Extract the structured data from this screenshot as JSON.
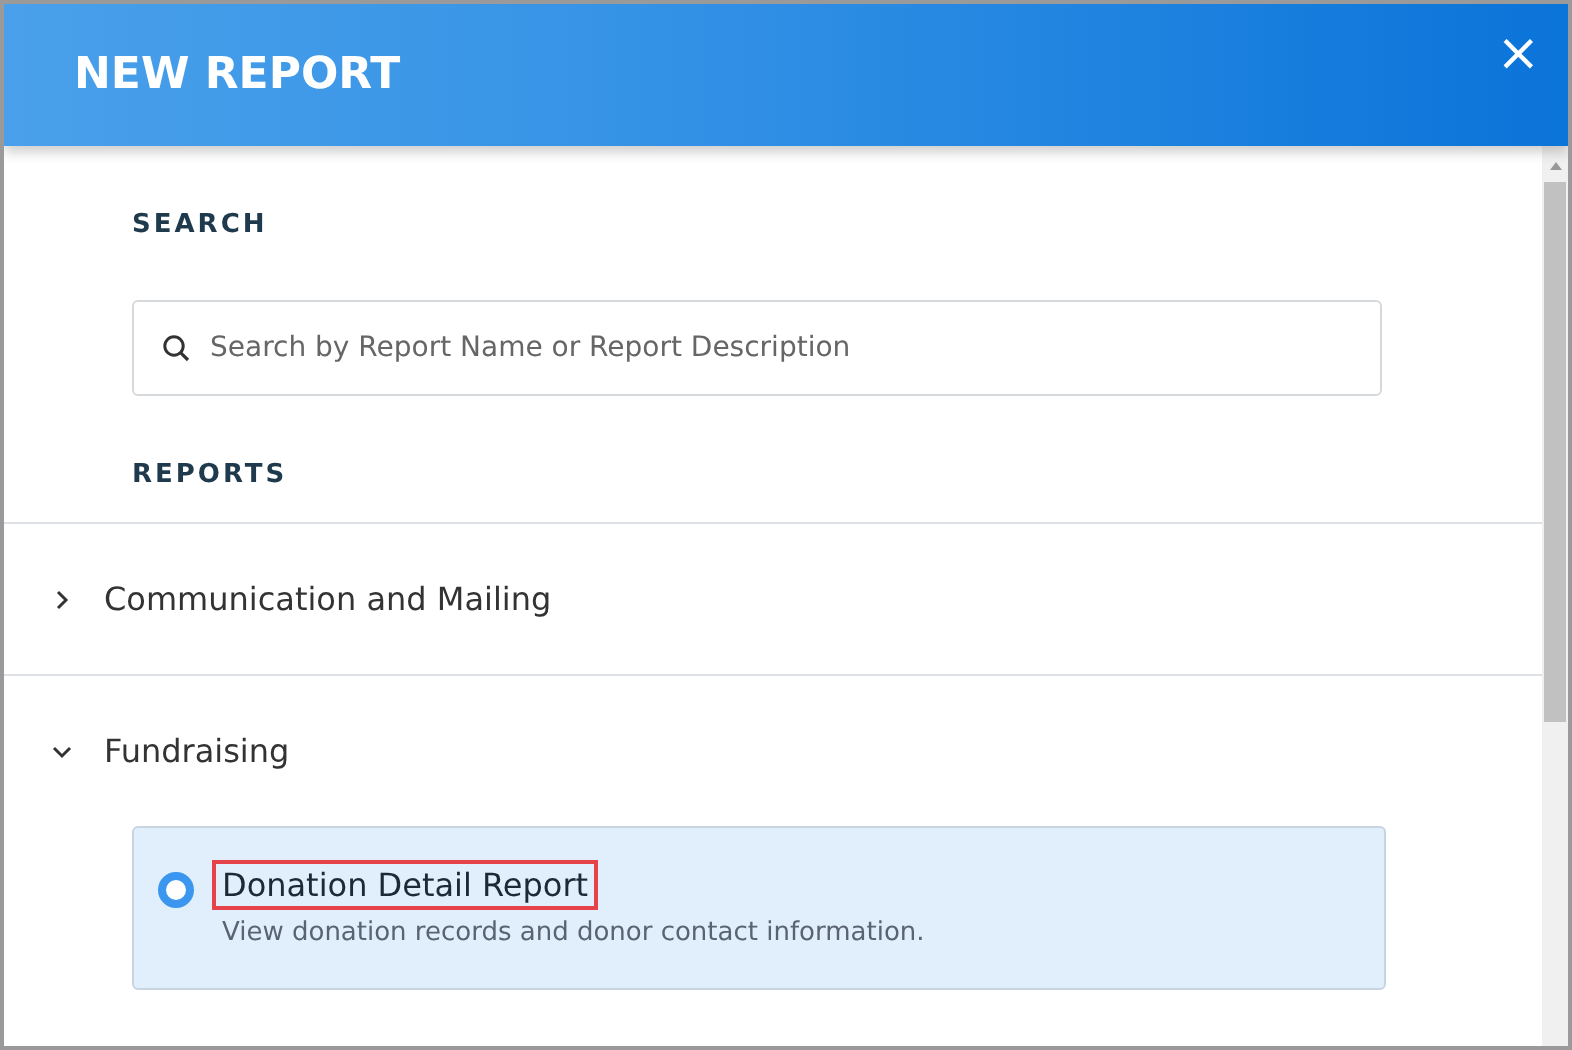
{
  "dialog": {
    "title": "NEW REPORT",
    "close": "×"
  },
  "search": {
    "label": "SEARCH",
    "placeholder": "Search by Report Name or Report Description"
  },
  "reports_label": "REPORTS",
  "categories": [
    {
      "name": "Communication and Mailing",
      "expanded": false
    },
    {
      "name": "Fundraising",
      "expanded": true,
      "reports": [
        {
          "name": "Donation Detail Report",
          "description": "View donation records and donor contact information.",
          "selected": true,
          "highlighted": true
        }
      ]
    }
  ]
}
